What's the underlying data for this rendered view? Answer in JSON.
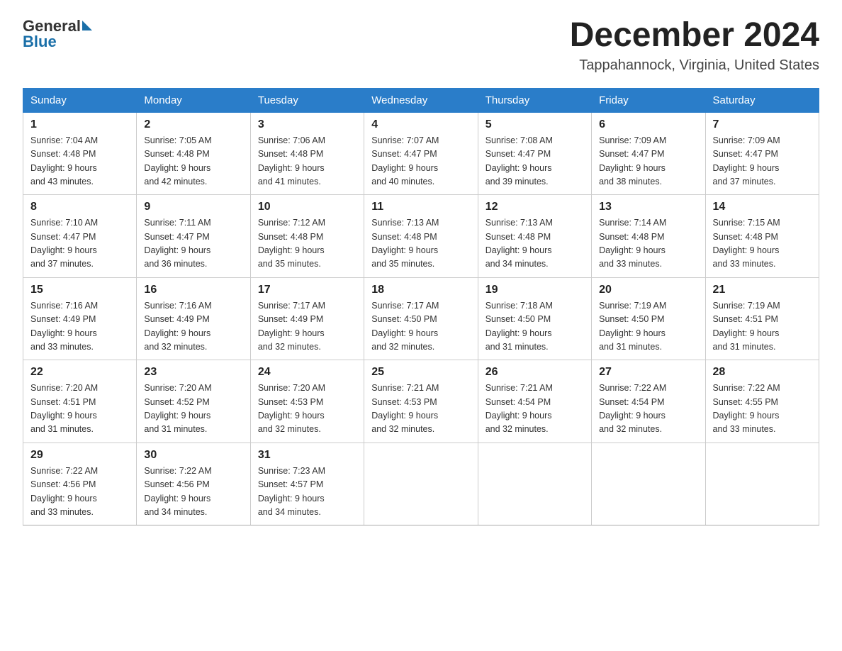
{
  "header": {
    "logo_general": "General",
    "logo_blue": "Blue",
    "month_title": "December 2024",
    "location": "Tappahannock, Virginia, United States"
  },
  "weekdays": [
    "Sunday",
    "Monday",
    "Tuesday",
    "Wednesday",
    "Thursday",
    "Friday",
    "Saturday"
  ],
  "weeks": [
    [
      {
        "day": "1",
        "sunrise": "7:04 AM",
        "sunset": "4:48 PM",
        "daylight": "9 hours and 43 minutes."
      },
      {
        "day": "2",
        "sunrise": "7:05 AM",
        "sunset": "4:48 PM",
        "daylight": "9 hours and 42 minutes."
      },
      {
        "day": "3",
        "sunrise": "7:06 AM",
        "sunset": "4:48 PM",
        "daylight": "9 hours and 41 minutes."
      },
      {
        "day": "4",
        "sunrise": "7:07 AM",
        "sunset": "4:47 PM",
        "daylight": "9 hours and 40 minutes."
      },
      {
        "day": "5",
        "sunrise": "7:08 AM",
        "sunset": "4:47 PM",
        "daylight": "9 hours and 39 minutes."
      },
      {
        "day": "6",
        "sunrise": "7:09 AM",
        "sunset": "4:47 PM",
        "daylight": "9 hours and 38 minutes."
      },
      {
        "day": "7",
        "sunrise": "7:09 AM",
        "sunset": "4:47 PM",
        "daylight": "9 hours and 37 minutes."
      }
    ],
    [
      {
        "day": "8",
        "sunrise": "7:10 AM",
        "sunset": "4:47 PM",
        "daylight": "9 hours and 37 minutes."
      },
      {
        "day": "9",
        "sunrise": "7:11 AM",
        "sunset": "4:47 PM",
        "daylight": "9 hours and 36 minutes."
      },
      {
        "day": "10",
        "sunrise": "7:12 AM",
        "sunset": "4:48 PM",
        "daylight": "9 hours and 35 minutes."
      },
      {
        "day": "11",
        "sunrise": "7:13 AM",
        "sunset": "4:48 PM",
        "daylight": "9 hours and 35 minutes."
      },
      {
        "day": "12",
        "sunrise": "7:13 AM",
        "sunset": "4:48 PM",
        "daylight": "9 hours and 34 minutes."
      },
      {
        "day": "13",
        "sunrise": "7:14 AM",
        "sunset": "4:48 PM",
        "daylight": "9 hours and 33 minutes."
      },
      {
        "day": "14",
        "sunrise": "7:15 AM",
        "sunset": "4:48 PM",
        "daylight": "9 hours and 33 minutes."
      }
    ],
    [
      {
        "day": "15",
        "sunrise": "7:16 AM",
        "sunset": "4:49 PM",
        "daylight": "9 hours and 33 minutes."
      },
      {
        "day": "16",
        "sunrise": "7:16 AM",
        "sunset": "4:49 PM",
        "daylight": "9 hours and 32 minutes."
      },
      {
        "day": "17",
        "sunrise": "7:17 AM",
        "sunset": "4:49 PM",
        "daylight": "9 hours and 32 minutes."
      },
      {
        "day": "18",
        "sunrise": "7:17 AM",
        "sunset": "4:50 PM",
        "daylight": "9 hours and 32 minutes."
      },
      {
        "day": "19",
        "sunrise": "7:18 AM",
        "sunset": "4:50 PM",
        "daylight": "9 hours and 31 minutes."
      },
      {
        "day": "20",
        "sunrise": "7:19 AM",
        "sunset": "4:50 PM",
        "daylight": "9 hours and 31 minutes."
      },
      {
        "day": "21",
        "sunrise": "7:19 AM",
        "sunset": "4:51 PM",
        "daylight": "9 hours and 31 minutes."
      }
    ],
    [
      {
        "day": "22",
        "sunrise": "7:20 AM",
        "sunset": "4:51 PM",
        "daylight": "9 hours and 31 minutes."
      },
      {
        "day": "23",
        "sunrise": "7:20 AM",
        "sunset": "4:52 PM",
        "daylight": "9 hours and 31 minutes."
      },
      {
        "day": "24",
        "sunrise": "7:20 AM",
        "sunset": "4:53 PM",
        "daylight": "9 hours and 32 minutes."
      },
      {
        "day": "25",
        "sunrise": "7:21 AM",
        "sunset": "4:53 PM",
        "daylight": "9 hours and 32 minutes."
      },
      {
        "day": "26",
        "sunrise": "7:21 AM",
        "sunset": "4:54 PM",
        "daylight": "9 hours and 32 minutes."
      },
      {
        "day": "27",
        "sunrise": "7:22 AM",
        "sunset": "4:54 PM",
        "daylight": "9 hours and 32 minutes."
      },
      {
        "day": "28",
        "sunrise": "7:22 AM",
        "sunset": "4:55 PM",
        "daylight": "9 hours and 33 minutes."
      }
    ],
    [
      {
        "day": "29",
        "sunrise": "7:22 AM",
        "sunset": "4:56 PM",
        "daylight": "9 hours and 33 minutes."
      },
      {
        "day": "30",
        "sunrise": "7:22 AM",
        "sunset": "4:56 PM",
        "daylight": "9 hours and 34 minutes."
      },
      {
        "day": "31",
        "sunrise": "7:23 AM",
        "sunset": "4:57 PM",
        "daylight": "9 hours and 34 minutes."
      },
      null,
      null,
      null,
      null
    ]
  ]
}
